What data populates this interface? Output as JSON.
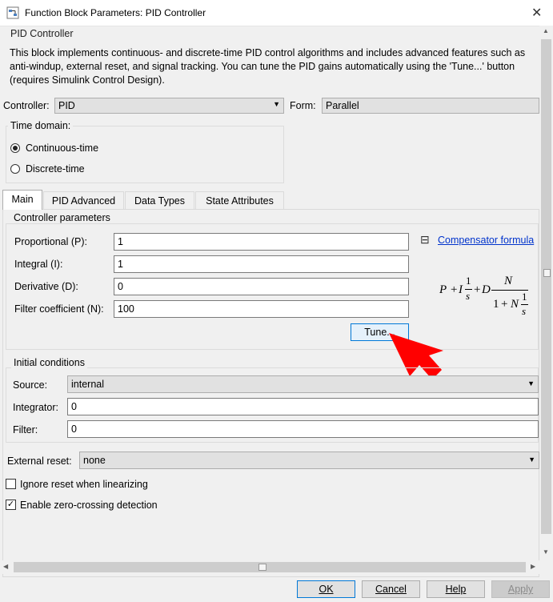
{
  "window": {
    "title": "Function Block Parameters: PID Controller"
  },
  "header": {
    "block_name": "PID Controller",
    "description": "This block implements continuous- and discrete-time PID control algorithms and includes advanced features such as anti-windup, external reset, and signal tracking. You can tune the PID gains automatically using the 'Tune...' button (requires Simulink Control Design)."
  },
  "controller": {
    "label": "Controller:",
    "value": "PID"
  },
  "form": {
    "label": "Form:",
    "value": "Parallel"
  },
  "time_domain": {
    "legend": "Time domain:",
    "options": [
      {
        "label": "Continuous-time",
        "selected": true
      },
      {
        "label": "Discrete-time",
        "selected": false
      }
    ]
  },
  "tabs": [
    {
      "label": "Main",
      "active": true
    },
    {
      "label": "PID Advanced",
      "active": false
    },
    {
      "label": "Data Types",
      "active": false
    },
    {
      "label": "State Attributes",
      "active": false
    }
  ],
  "controller_parameters": {
    "legend": "Controller parameters",
    "fields": [
      {
        "label": "Proportional (P):",
        "value": "1"
      },
      {
        "label": "Integral (I):",
        "value": "1"
      },
      {
        "label": "Derivative (D):",
        "value": "0"
      },
      {
        "label": "Filter coefficient (N):",
        "value": "100"
      }
    ],
    "tune_label": "Tune...",
    "compensator_toggle": "⊟",
    "compensator_link": "Compensator formula",
    "formula": {
      "p": "P",
      "plus1": "+",
      "i": "I",
      "one1": "1",
      "s1": "s",
      "plus2": "+",
      "d": "D",
      "num_n": "N",
      "den_one": "1",
      "den_plus": "+",
      "den_n": "N",
      "den_frac_one": "1",
      "den_s": "s"
    }
  },
  "initial_conditions": {
    "legend": "Initial conditions",
    "source_label": "Source:",
    "source_value": "internal",
    "integrator_label": "Integrator:",
    "integrator_value": "0",
    "filter_label": "Filter:",
    "filter_value": "0"
  },
  "external_reset": {
    "label": "External reset:",
    "value": "none"
  },
  "checkboxes": [
    {
      "label": "Ignore reset when linearizing",
      "checked": false
    },
    {
      "label": "Enable zero-crossing detection",
      "checked": true
    }
  ],
  "buttons": {
    "ok": "OK",
    "cancel": "Cancel",
    "help": "Help",
    "apply": "Apply"
  },
  "icons": {
    "close": "✕",
    "combo_arrow": "▼",
    "check_mark": "✓",
    "scroll_up": "▲",
    "scroll_down": "▼",
    "scroll_left": "◀",
    "scroll_right": "▶"
  }
}
